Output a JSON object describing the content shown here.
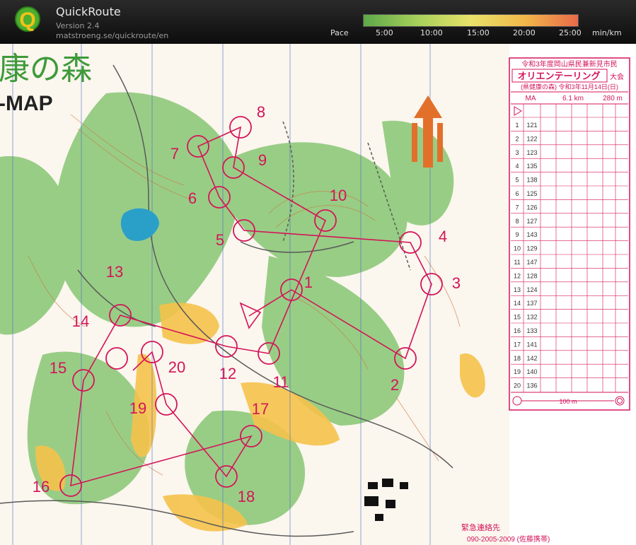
{
  "app": {
    "title": "QuickRoute",
    "version": "Version 2.4",
    "url": "matstroeng.se/quickroute/en",
    "logo_letter": "Q"
  },
  "pace": {
    "label": "Pace",
    "ticks": [
      "5:00",
      "10:00",
      "15:00",
      "20:00",
      "25:00"
    ],
    "unit": "min/km",
    "gradient_colors": [
      "#5ea84a",
      "#a6cf5a",
      "#e8e26a",
      "#f0b84a",
      "#e86a4a"
    ]
  },
  "map": {
    "title_jp": "康の森",
    "title_en": "-MAP",
    "north_letter": "N",
    "controls": [
      "1",
      "2",
      "3",
      "4",
      "5",
      "6",
      "7",
      "8",
      "9",
      "10",
      "11",
      "12",
      "13",
      "14",
      "15",
      "16",
      "17",
      "18",
      "19",
      "20"
    ],
    "emergency": "緊急連絡先",
    "phone": "090-2005-2009 (佐藤携帯)"
  },
  "legend": {
    "header1": "令和3年度岡山県民兼新見市民",
    "header2": "オリエンテーリング",
    "header2_suffix": "大会",
    "header3": "(県健康の森) 令和3年11月14日(日)",
    "class": "MA",
    "length": "6.1 km",
    "climb": "280 m",
    "rows": [
      {
        "n": "1",
        "code": "121"
      },
      {
        "n": "2",
        "code": "122"
      },
      {
        "n": "3",
        "code": "123"
      },
      {
        "n": "4",
        "code": "135"
      },
      {
        "n": "5",
        "code": "138"
      },
      {
        "n": "6",
        "code": "125"
      },
      {
        "n": "7",
        "code": "126"
      },
      {
        "n": "8",
        "code": "127"
      },
      {
        "n": "9",
        "code": "143"
      },
      {
        "n": "10",
        "code": "129"
      },
      {
        "n": "11",
        "code": "147"
      },
      {
        "n": "12",
        "code": "128"
      },
      {
        "n": "13",
        "code": "124"
      },
      {
        "n": "14",
        "code": "137"
      },
      {
        "n": "15",
        "code": "132"
      },
      {
        "n": "16",
        "code": "133"
      },
      {
        "n": "17",
        "code": "141"
      },
      {
        "n": "18",
        "code": "142"
      },
      {
        "n": "19",
        "code": "140"
      },
      {
        "n": "20",
        "code": "136"
      }
    ],
    "footer": "100 m"
  }
}
